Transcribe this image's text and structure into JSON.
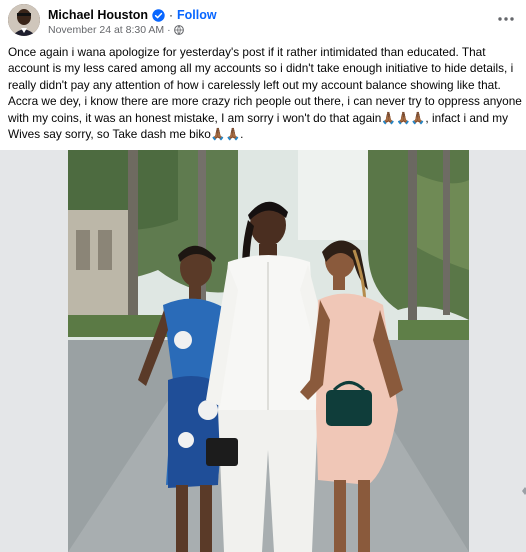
{
  "post": {
    "author": "Michael Houston",
    "separator": "·",
    "follow_label": "Follow",
    "timestamp": "November 24 at 8:30 AM",
    "meta_separator": "·",
    "text": "Once again i wana apologize for yesterday's post if it rather intimidated than educated. That account is my less cared among all my accounts so i didn't take enough initiative to hide details, i really didn't pay any attention of how i carelessly left out my account balance showing like that. Accra we dey, i know there are more crazy rich people out there, i can never try to oppress anyone with my coins, it was an honest mistake, I am sorry i won't do that again🙏🏾🙏🏾🙏🏾, infact i and my Wives say sorry, so Take dash me biko🙏🏾🙏🏾."
  },
  "icons": {
    "verified": "verified-badge-icon",
    "privacy": "globe-icon",
    "more": "more-options-icon"
  },
  "colors": {
    "link": "#0866ff",
    "secondary_text": "#65676b",
    "verified": "#0866ff"
  }
}
